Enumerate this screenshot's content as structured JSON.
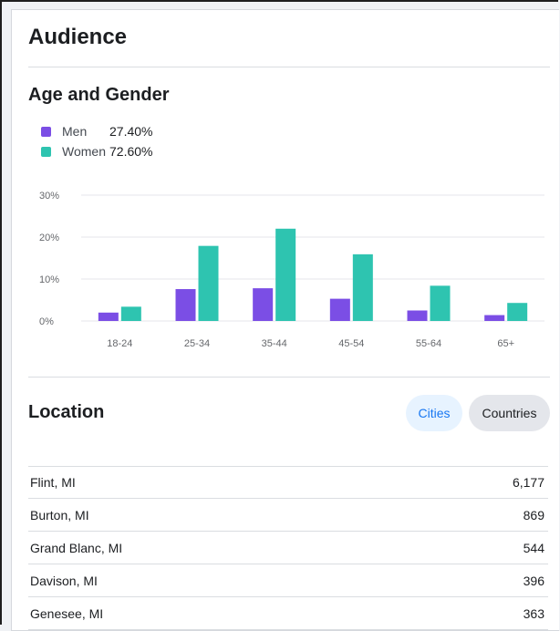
{
  "audience": {
    "title": "Audience"
  },
  "age_gender": {
    "title": "Age and Gender",
    "legend": [
      {
        "name": "Men",
        "value": "27.40%",
        "color": "#7b4ee5"
      },
      {
        "name": "Women",
        "value": "72.60%",
        "color": "#2ec4b0"
      }
    ]
  },
  "chart_data": {
    "type": "bar",
    "categories": [
      "18-24",
      "25-34",
      "35-44",
      "45-54",
      "55-64",
      "65+"
    ],
    "series": [
      {
        "name": "Men",
        "values": [
          2.0,
          7.6,
          7.8,
          5.3,
          2.5,
          1.4
        ],
        "color": "#7b4ee5"
      },
      {
        "name": "Women",
        "values": [
          3.4,
          17.9,
          22.0,
          15.9,
          8.4,
          4.3
        ],
        "color": "#2ec4b0"
      }
    ],
    "yticks": [
      "0%",
      "10%",
      "20%",
      "30%"
    ],
    "ylim": [
      0,
      30
    ],
    "grid": true
  },
  "location": {
    "title": "Location",
    "tabs": {
      "cities": "Cities",
      "countries": "Countries"
    },
    "rows": [
      {
        "name": "Flint, MI",
        "count": "6,177"
      },
      {
        "name": "Burton, MI",
        "count": "869"
      },
      {
        "name": "Grand Blanc, MI",
        "count": "544"
      },
      {
        "name": "Davison, MI",
        "count": "396"
      },
      {
        "name": "Genesee, MI",
        "count": "363"
      }
    ]
  }
}
